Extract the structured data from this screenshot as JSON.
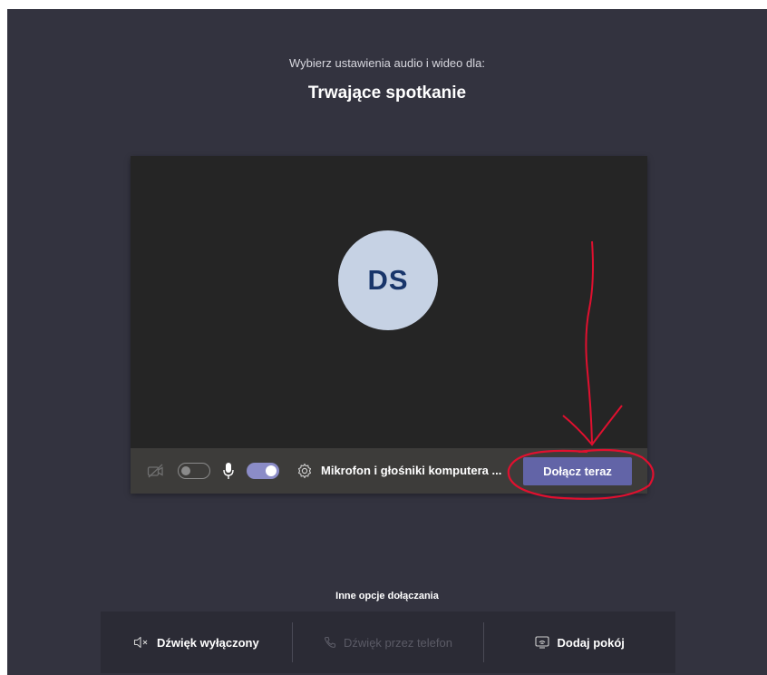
{
  "header": {
    "subtitle": "Wybierz ustawienia audio i wideo dla:",
    "meeting_title": "Trwające spotkanie"
  },
  "preview": {
    "avatar_initials": "DS"
  },
  "controls": {
    "camera_on": false,
    "mic_on": true,
    "device_label": "Mikrofon i głośniki komputera ...",
    "join_label": "Dołącz teraz"
  },
  "other_options": {
    "label": "Inne opcje dołączania",
    "items": [
      {
        "label": "Dźwięk wyłączony",
        "icon": "speaker-off-icon",
        "enabled": true
      },
      {
        "label": "Dźwięk przez telefon",
        "icon": "phone-icon",
        "enabled": false
      },
      {
        "label": "Dodaj pokój",
        "icon": "room-cast-icon",
        "enabled": true
      }
    ]
  },
  "colors": {
    "background": "#33333f",
    "preview": "#252525",
    "accent": "#6264a7",
    "toggle_on": "#8b8cc7",
    "avatar_bg": "#c6d2e4",
    "avatar_text": "#18356a",
    "annotation": "#e0102f"
  }
}
